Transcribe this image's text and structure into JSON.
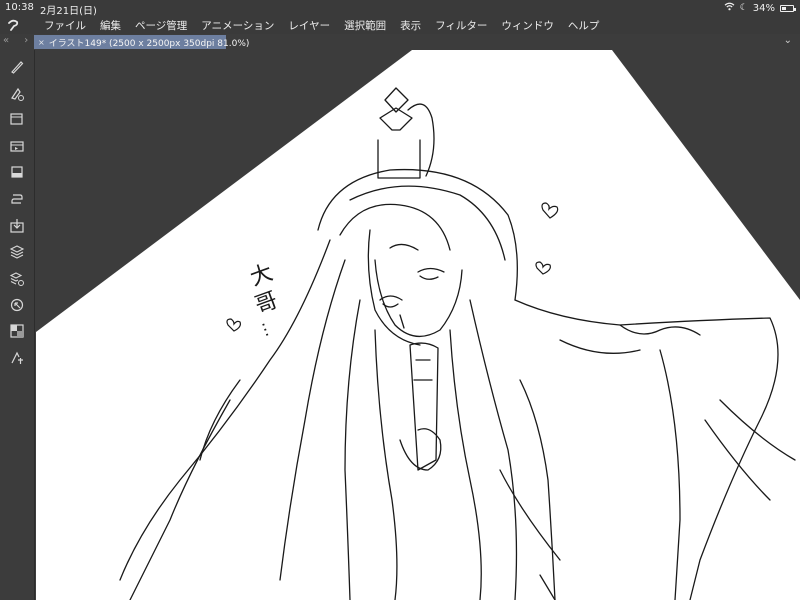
{
  "status": {
    "time": "10:38",
    "date": "2月21日(日)",
    "battery": "34%"
  },
  "menu": [
    "ファイル",
    "編集",
    "ページ管理",
    "アニメーション",
    "レイヤー",
    "選択範囲",
    "表示",
    "フィルター",
    "ウィンドウ",
    "ヘルプ"
  ],
  "tab": {
    "nav": "« ›",
    "title": "イラスト149* (2500 x 2500px 350dpi 81.0%)",
    "close": "×",
    "more": "⌄"
  },
  "tools": [
    "pen-tool",
    "fill-tool",
    "layer-panel",
    "animation-timeline",
    "material",
    "transform-tool",
    "import",
    "layers-stack",
    "layer-properties",
    "navigator",
    "color-picker",
    "text-tool"
  ],
  "canvas": {
    "paper_color": "#ffffff",
    "line_color": "#1a1a1a",
    "handwriting": [
      "大",
      "哥",
      "…"
    ]
  }
}
